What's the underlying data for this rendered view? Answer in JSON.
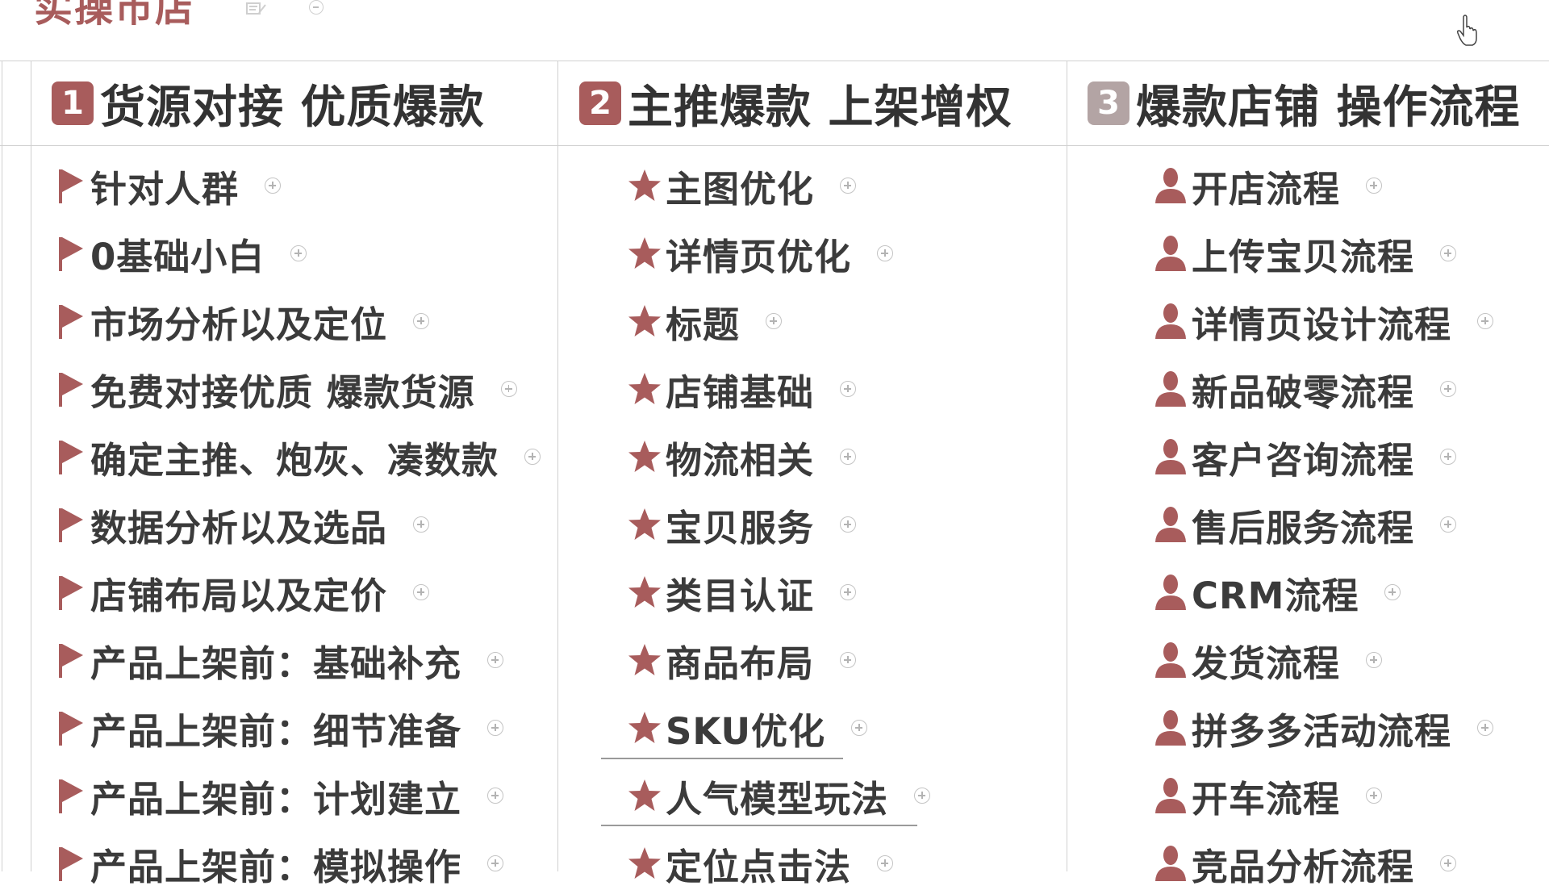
{
  "document_title": "实操市店",
  "columns": [
    {
      "number": "1",
      "header": "货源对接  优质爆款",
      "icon": "flag-icon",
      "items": [
        "针对人群",
        "0基础小白",
        "市场分析以及定位",
        "免费对接优质 爆款货源",
        "确定主推、炮灰、凑数款",
        "数据分析以及选品",
        "店铺布局以及定价",
        "产品上架前：基础补充",
        "产品上架前：细节准备",
        "产品上架前：计划建立",
        "产品上架前：模拟操作"
      ]
    },
    {
      "number": "2",
      "header": "主推爆款 上架增权",
      "icon": "star-icon",
      "items": [
        "主图优化",
        "详情页优化",
        "标题",
        "店铺基础",
        "物流相关",
        "宝贝服务",
        "类目认证",
        "商品布局",
        "SKU优化",
        "人气模型玩法",
        "定位点击法"
      ]
    },
    {
      "number": "3",
      "header": "爆款店铺 操作流程",
      "icon": "person-icon",
      "items": [
        "开店流程",
        "上传宝贝流程",
        "详情页设计流程",
        "新品破零流程",
        "客户咨询流程",
        "售后服务流程",
        "CRM流程",
        "发货流程",
        "拼多多活动流程",
        "开车流程",
        "竞品分析流程"
      ]
    }
  ],
  "colors": {
    "accent": "#a85c5c",
    "badge_light": "#b3a4a4",
    "text": "#3b3b3b",
    "grid": "#d0d0d0"
  }
}
